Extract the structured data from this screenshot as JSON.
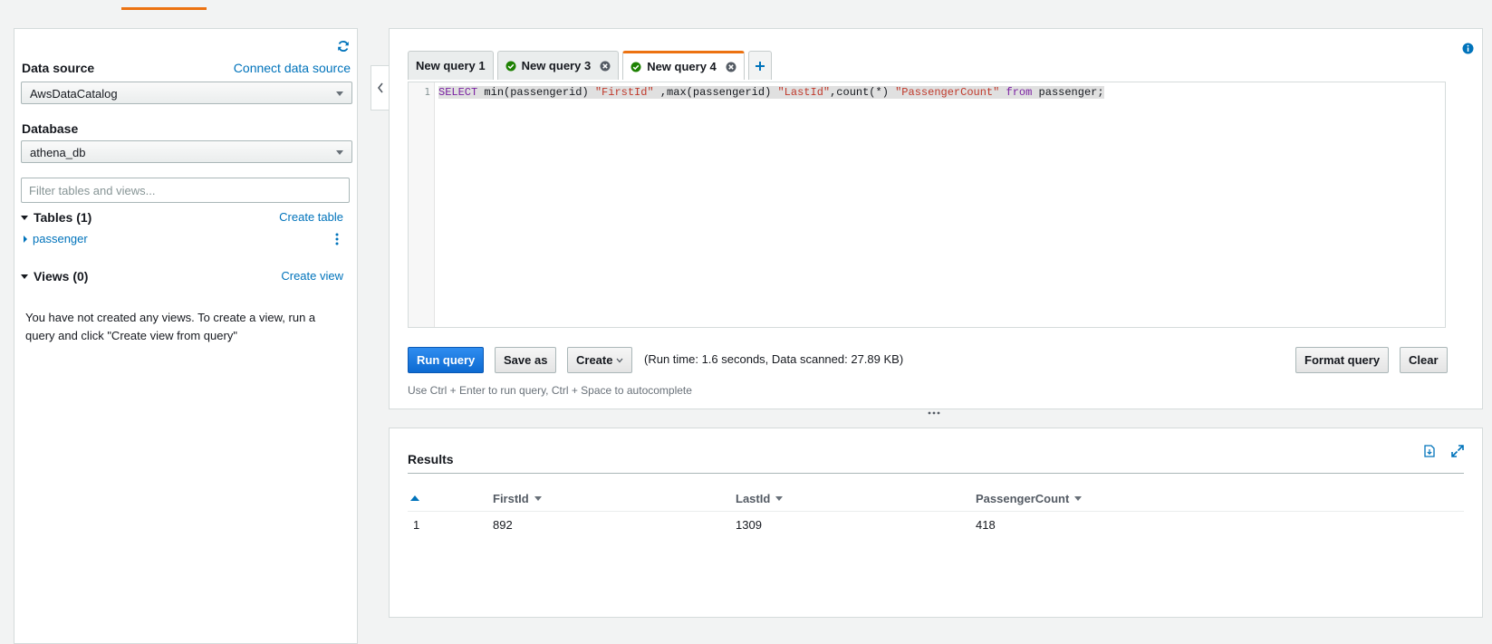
{
  "sidebar": {
    "data_source_label": "Data source",
    "connect_link": "Connect data source",
    "data_source_value": "AwsDataCatalog",
    "database_label": "Database",
    "database_value": "athena_db",
    "filter_placeholder": "Filter tables and views...",
    "tables_header": "Tables (1)",
    "create_table": "Create table",
    "tables": [
      "passenger"
    ],
    "views_header": "Views (0)",
    "create_view": "Create view",
    "views_empty_note": "You have not created any views. To create a view, run a query and click \"Create view from query\""
  },
  "editor": {
    "tabs": [
      {
        "label": "New query 1",
        "status": "none",
        "closable": false
      },
      {
        "label": "New query 3",
        "status": "success",
        "closable": true
      },
      {
        "label": "New query 4",
        "status": "success",
        "closable": true,
        "active": true
      }
    ],
    "line_number": "1",
    "code": {
      "t1": "SELECT",
      "t2": " min(passengerid) ",
      "t3": "\"FirstId\"",
      "t4": " ,max(passengerid) ",
      "t5": "\"LastId\"",
      "t6": ",count(*) ",
      "t7": "\"PassengerCount\"",
      "t8": " from",
      "t9": " passenger;"
    },
    "buttons": {
      "run": "Run query",
      "save_as": "Save as",
      "create": "Create",
      "format": "Format query",
      "clear": "Clear"
    },
    "run_stats": "(Run time: 1.6 seconds, Data scanned: 27.89 KB)",
    "hint": "Use Ctrl + Enter to run query, Ctrl + Space to autocomplete"
  },
  "results": {
    "title": "Results",
    "columns": [
      "FirstId",
      "LastId",
      "PassengerCount"
    ],
    "rows": [
      {
        "index": "1",
        "values": [
          "892",
          "1309",
          "418"
        ]
      }
    ]
  },
  "colors": {
    "accent_orange": "#ec7211",
    "link_blue": "#0073bb",
    "primary_button": "#0d6ad1",
    "success_green": "#1d8102"
  }
}
